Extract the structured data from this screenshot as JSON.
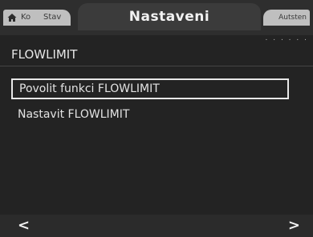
{
  "header": {
    "home_tab": {
      "icon": "home-icon",
      "label_1": "Ko",
      "label_2": "Stav"
    },
    "active_tab": {
      "label": "Nastaveni"
    },
    "right_tab": {
      "label": "Autsten"
    }
  },
  "page": {
    "dots": ". . . . . .",
    "title": "FLOWLIMIT"
  },
  "menu": {
    "items": [
      {
        "label": "Povolit funkci FLOWLIMIT",
        "selected": true
      },
      {
        "label": "Nastavit FLOWLIMIT",
        "selected": false
      }
    ]
  },
  "footer": {
    "left_arrow": "<",
    "right_arrow": ">"
  },
  "colors": {
    "background": "#232323",
    "tab_inactive": "#bfbfbf",
    "text": "#e3e3e3",
    "selection_border": "#e8e8e8"
  }
}
